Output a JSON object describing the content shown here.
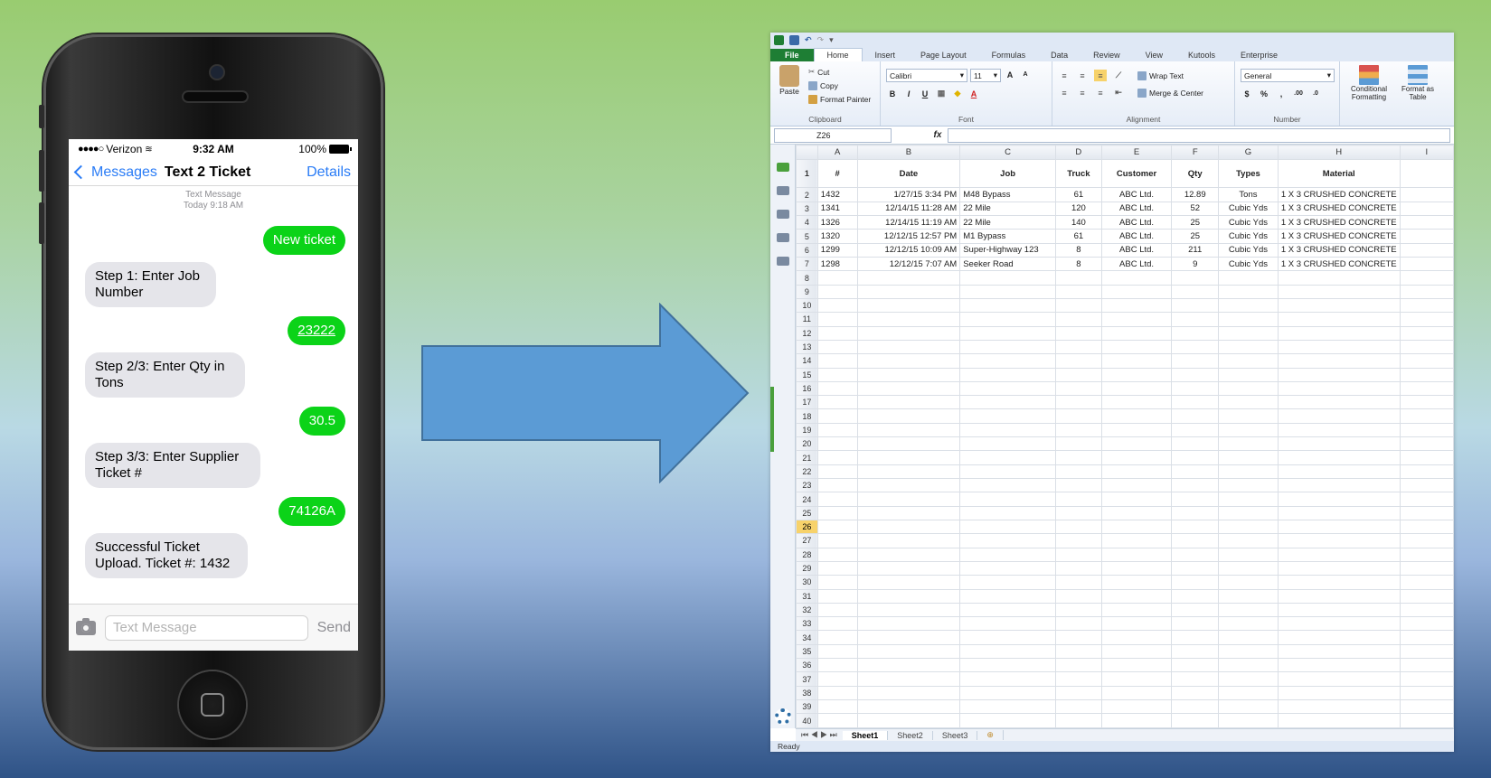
{
  "phone": {
    "status": {
      "carrier": "Verizon",
      "time": "9:32 AM",
      "battery": "100%"
    },
    "nav": {
      "back": "Messages",
      "title": "Text 2 Ticket",
      "details": "Details"
    },
    "meta": {
      "type": "Text Message",
      "when": "Today 9:18 AM"
    },
    "messages": [
      {
        "dir": "out",
        "text": "New ticket"
      },
      {
        "dir": "in",
        "text": "Step 1: Enter Job Number"
      },
      {
        "dir": "out",
        "text": "23222"
      },
      {
        "dir": "in",
        "text": "Step 2/3: Enter Qty in Tons"
      },
      {
        "dir": "out",
        "text": "30.5"
      },
      {
        "dir": "in",
        "text": "Step 3/3: Enter Supplier Ticket #"
      },
      {
        "dir": "out",
        "text": "74126A"
      },
      {
        "dir": "in",
        "text": "Successful Ticket Upload. Ticket #: 1432"
      }
    ],
    "input": {
      "placeholder": "Text Message",
      "send": "Send"
    },
    "colors": {
      "outgoing": "#0bd318",
      "incoming": "#e5e5ea",
      "link": "#2a7cf6"
    }
  },
  "excel": {
    "tabs": [
      "File",
      "Home",
      "Insert",
      "Page Layout",
      "Formulas",
      "Data",
      "Review",
      "View",
      "Kutools",
      "Enterprise"
    ],
    "clipboard": {
      "paste": "Paste",
      "cut": "Cut",
      "copy": "Copy",
      "format_painter": "Format Painter",
      "label": "Clipboard"
    },
    "font": {
      "name": "Calibri",
      "size": "11",
      "label": "Font"
    },
    "alignment": {
      "wrap": "Wrap Text",
      "merge": "Merge & Center",
      "label": "Alignment"
    },
    "number": {
      "format": "General",
      "label": "Number"
    },
    "styles": {
      "conditional": "Conditional Formatting",
      "format_table": "Format as Table"
    },
    "namebox": "Z26",
    "columns": [
      "A",
      "B",
      "C",
      "D",
      "E",
      "F",
      "G",
      "H",
      "I"
    ],
    "headers": [
      "#",
      "Date",
      "Job",
      "Truck",
      "Customer",
      "Qty",
      "Types",
      "Material"
    ],
    "rows": [
      [
        "1432",
        "1/27/15 3:34 PM",
        "M48 Bypass",
        "61",
        "ABC Ltd.",
        "12.89",
        "Tons",
        "1 X 3 CRUSHED CONCRETE"
      ],
      [
        "1341",
        "12/14/15 11:28 AM",
        "22 Mile",
        "120",
        "ABC Ltd.",
        "52",
        "Cubic Yds",
        "1 X 3 CRUSHED CONCRETE"
      ],
      [
        "1326",
        "12/14/15 11:19 AM",
        "22 Mile",
        "140",
        "ABC Ltd.",
        "25",
        "Cubic Yds",
        "1 X 3 CRUSHED CONCRETE"
      ],
      [
        "1320",
        "12/12/15 12:57 PM",
        "M1 Bypass",
        "61",
        "ABC Ltd.",
        "25",
        "Cubic Yds",
        "1 X 3 CRUSHED CONCRETE"
      ],
      [
        "1299",
        "12/12/15 10:09 AM",
        "Super-Highway 123",
        "8",
        "ABC Ltd.",
        "211",
        "Cubic Yds",
        "1 X 3 CRUSHED CONCRETE"
      ],
      [
        "1298",
        "12/12/15 7:07 AM",
        "Seeker Road",
        "8",
        "ABC Ltd.",
        "9",
        "Cubic Yds",
        "1 X 3 CRUSHED CONCRETE"
      ]
    ],
    "row_numbers": [
      "1",
      "2",
      "3",
      "4",
      "5",
      "6",
      "7",
      "8",
      "9",
      "10",
      "11",
      "12",
      "13",
      "14",
      "15",
      "16",
      "17",
      "18",
      "19",
      "20",
      "21",
      "22",
      "23",
      "24",
      "25",
      "26",
      "27",
      "28",
      "29",
      "30",
      "31",
      "32",
      "33",
      "34",
      "35",
      "36",
      "37",
      "38",
      "39",
      "40"
    ],
    "selected_row": "26",
    "sheets": [
      "Sheet1",
      "Sheet2",
      "Sheet3"
    ],
    "status": "Ready",
    "colors": {
      "file_tab": "#1e7e34",
      "selection": "#f7d26a"
    }
  },
  "arrow": {
    "color": "#5b9bd5",
    "icon": "right-arrow-icon"
  }
}
